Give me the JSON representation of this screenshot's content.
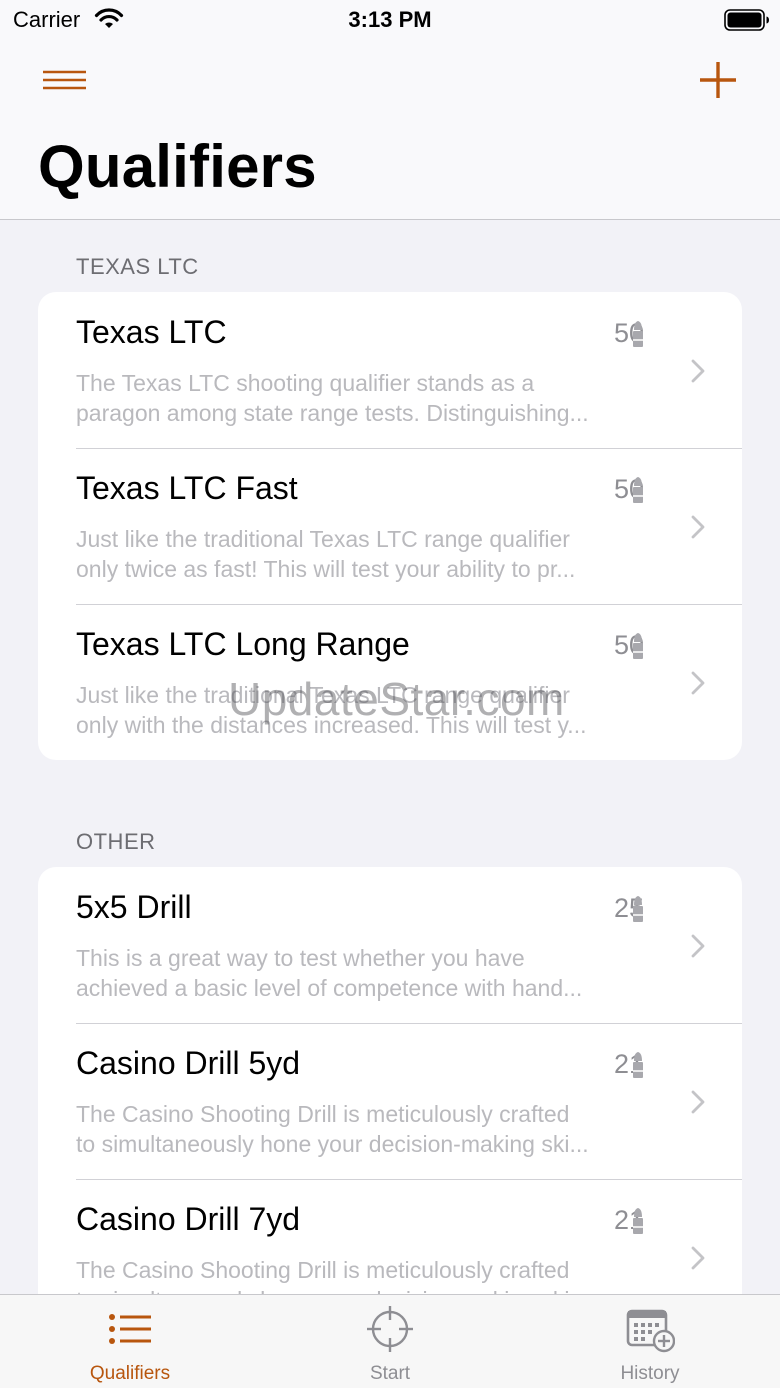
{
  "status_bar": {
    "carrier": "Carrier",
    "time": "3:13 PM"
  },
  "nav": {
    "title": "Qualifiers",
    "menu_icon": "hamburger-menu-icon",
    "add_icon": "plus-icon"
  },
  "colors": {
    "accent": "#b8560e",
    "inactive": "#8e8e93",
    "background": "#f2f2f7"
  },
  "sections": [
    {
      "header": "TEXAS LTC",
      "items": [
        {
          "title": "Texas LTC",
          "count": "50",
          "desc": [
            "The Texas LTC shooting qualifier stands as a",
            "paragon among state range tests. Distinguishing..."
          ]
        },
        {
          "title": "Texas LTC Fast",
          "count": "50",
          "desc": [
            "Just like the traditional Texas LTC range qualifier",
            "only twice as fast! This will test your ability to pr..."
          ]
        },
        {
          "title": "Texas LTC Long Range",
          "count": "50",
          "desc": [
            "Just like the traditional Texas LTC range qualifier",
            "only with the distances increased. This will test y..."
          ]
        }
      ]
    },
    {
      "header": "OTHER",
      "items": [
        {
          "title": "5x5 Drill",
          "count": "25",
          "desc": [
            "This is a great way to test whether you have",
            "achieved a basic level of competence with hand..."
          ]
        },
        {
          "title": "Casino Drill 5yd",
          "count": "21",
          "desc": [
            "The Casino Shooting Drill is meticulously crafted",
            "to simultaneously hone your decision-making ski..."
          ]
        },
        {
          "title": "Casino Drill 7yd",
          "count": "21",
          "desc": [
            "The Casino Shooting Drill is meticulously crafted",
            "to simultaneously hone your decision-making ski..."
          ]
        }
      ]
    }
  ],
  "watermark": "UpdateStar.com",
  "tabs": [
    {
      "label": "Qualifiers",
      "icon": "list-icon",
      "active": true
    },
    {
      "label": "Start",
      "icon": "crosshair-icon",
      "active": false
    },
    {
      "label": "History",
      "icon": "calendar-add-icon",
      "active": false
    }
  ]
}
